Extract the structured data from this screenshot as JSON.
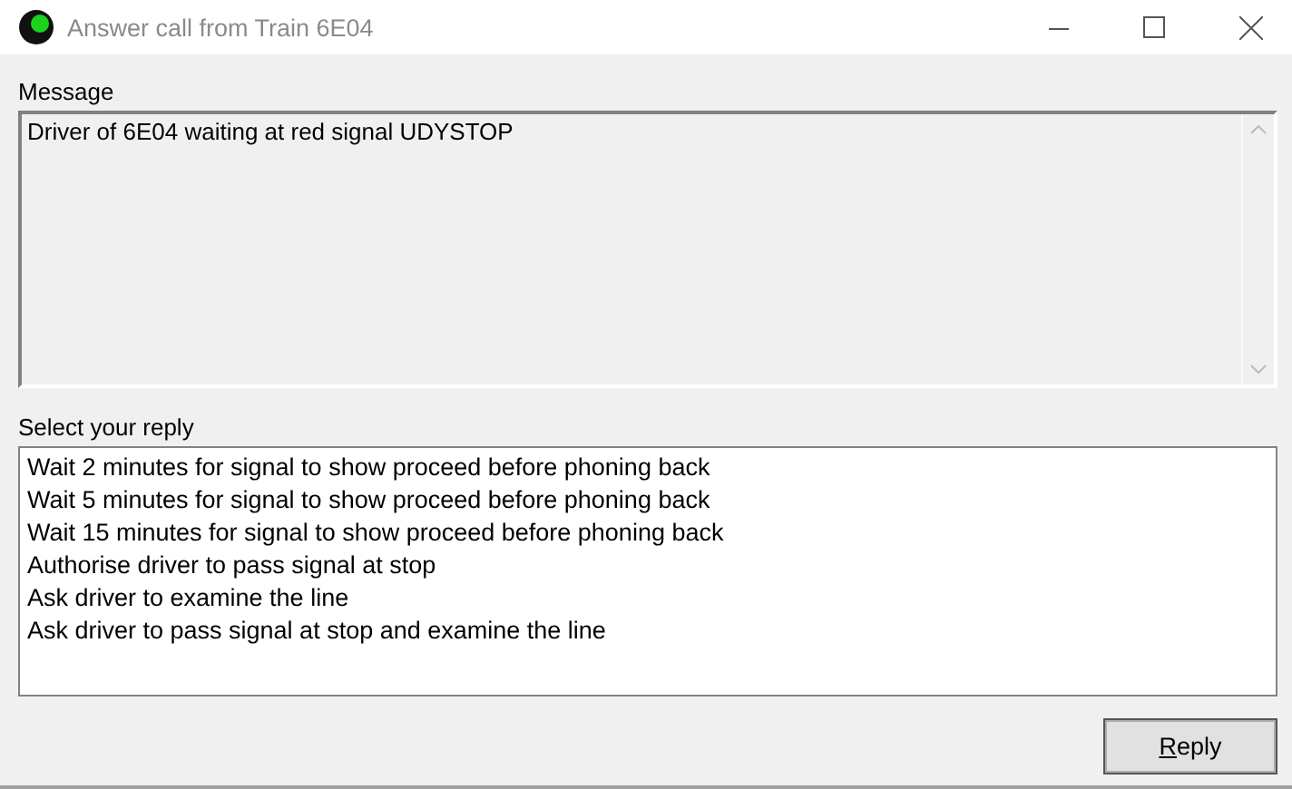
{
  "window": {
    "title": "Answer call from Train 6E04"
  },
  "message": {
    "label": "Message",
    "text": "Driver of 6E04 waiting at red signal UDYSTOP"
  },
  "reply_list": {
    "label": "Select your reply",
    "items": [
      {
        "text": "Wait 2 minutes for signal to show proceed before phoning back",
        "selected": false
      },
      {
        "text": "Wait 5 minutes for signal to show proceed before phoning back",
        "selected": false
      },
      {
        "text": "Wait 15 minutes for signal to show proceed before phoning back",
        "selected": false
      },
      {
        "text": "Authorise driver to pass signal at stop",
        "selected": false
      },
      {
        "text": "Ask driver to examine the line",
        "selected": false
      },
      {
        "text": "Ask driver to pass signal at stop and examine the line",
        "selected": false
      }
    ]
  },
  "buttons": [
    {
      "label": "Reply",
      "access_key_underlined": true
    }
  ]
}
